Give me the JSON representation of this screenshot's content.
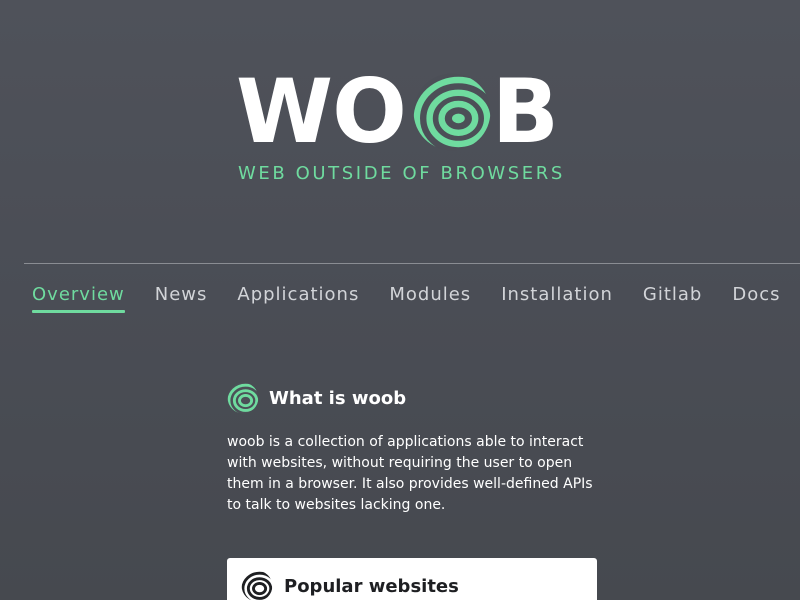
{
  "logo": {
    "text_before": "WO",
    "text_after": "B",
    "globe_icon": "striped-globe-icon",
    "tagline": "WEB OUTSIDE OF BROWSERS"
  },
  "nav": {
    "items": [
      {
        "label": "Overview",
        "active": true
      },
      {
        "label": "News",
        "active": false
      },
      {
        "label": "Applications",
        "active": false
      },
      {
        "label": "Modules",
        "active": false
      },
      {
        "label": "Installation",
        "active": false
      },
      {
        "label": "Gitlab",
        "active": false
      },
      {
        "label": "Docs",
        "active": false
      }
    ]
  },
  "about": {
    "icon": "striped-globe-icon",
    "title": "What is woob",
    "body": "woob is a collection of applications able to interact with websites, without requiring the user to open them in a browser. It also provides well-defined APIs to talk to websites lacking one."
  },
  "popular": {
    "icon": "striped-globe-icon",
    "title": "Popular websites"
  },
  "colors": {
    "accent": "#6fdb9f",
    "background": "#4c4f57",
    "text": "#ffffff",
    "nav_text": "#d2d4d8",
    "card_bg": "#ffffff",
    "card_text": "#1e1f22"
  }
}
